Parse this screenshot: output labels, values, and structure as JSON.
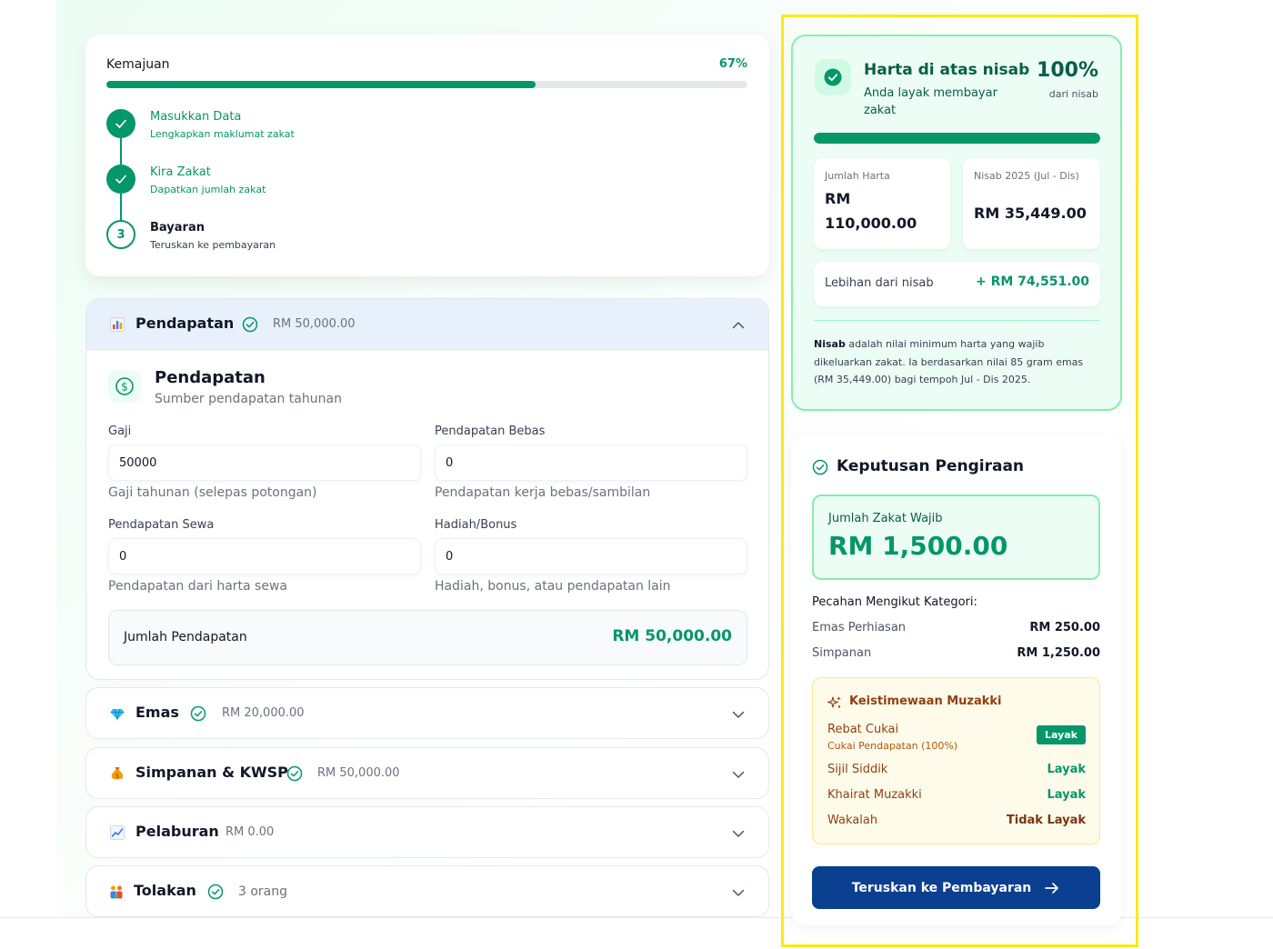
{
  "colors": {
    "accent": "#059669",
    "accent_dark": "#065f46",
    "primary_button": "#0b3f8f",
    "highlight": "#fde910",
    "amber": "#92400e"
  },
  "progress": {
    "title": "Kemajuan",
    "percent_label": "67%",
    "percent_value": 67,
    "steps": [
      {
        "title": "Masukkan Data",
        "subtitle": "Lengkapkan maklumat zakat",
        "status": "done"
      },
      {
        "title": "Kira Zakat",
        "subtitle": "Dapatkan jumlah zakat",
        "status": "done"
      },
      {
        "title": "Bayaran",
        "subtitle": "Teruskan ke pembayaran",
        "status": "current",
        "number": "3"
      }
    ]
  },
  "income": {
    "header": {
      "name": "Pendapatan",
      "amount": "RM 50,000.00",
      "icon": "bar-chart-icon",
      "completed_icon": "check-circle-icon",
      "toggle_icon": "chevron-up-icon"
    },
    "title": "Pendapatan",
    "subtitle": "Sumber pendapatan tahunan",
    "icon": "dollar-circle-icon",
    "fields": [
      {
        "label": "Gaji",
        "value": "50000",
        "help": "Gaji tahunan (selepas potongan)"
      },
      {
        "label": "Pendapatan Bebas",
        "value": "0",
        "help": "Pendapatan kerja bebas/sambilan"
      },
      {
        "label": "Pendapatan Sewa",
        "value": "0",
        "help": "Pendapatan dari harta sewa"
      },
      {
        "label": "Hadiah/Bonus",
        "value": "0",
        "help": "Hadiah, bonus, atau pendapatan lain"
      }
    ],
    "total_label": "Jumlah Pendapatan",
    "total_value": "RM 50,000.00"
  },
  "sections": [
    {
      "name": "Emas",
      "amount": "RM 20,000.00",
      "icon": "gem-icon",
      "completed": true
    },
    {
      "name": "Simpanan & KWSP",
      "amount": "RM 50,000.00",
      "icon": "money-bag-icon",
      "completed": true
    },
    {
      "name": "Pelaburan",
      "amount": "RM 0.00",
      "icon": "trend-chart-icon",
      "completed": false
    },
    {
      "name": "Tolakan",
      "amount": "3 orang",
      "icon": "family-icon",
      "completed": true
    }
  ],
  "nisab": {
    "title": "Harta di atas nisab",
    "subtitle": "Anda layak membayar zakat",
    "percent": "100%",
    "percent_sub": "dari nisab",
    "bar_percent": 100,
    "total_assets_label": "Jumlah Harta",
    "total_assets_currency": "RM",
    "total_assets_value": "110,000.00",
    "nisab_label": "Nisab 2025 (Jul - Dis)",
    "nisab_value": "RM 35,449.00",
    "excess_label": "Lebihan dari nisab",
    "excess_value": "+ RM 74,551.00",
    "note_term": "Nisab",
    "note_text": " adalah nilai minimum harta yang wajib dikeluarkan zakat. Ia berdasarkan nilai 85 gram emas (RM 35,449.00) bagi tempoh Jul - Dis 2025."
  },
  "decision": {
    "title": "Keputusan Pengiraan",
    "zakat_label": "Jumlah Zakat Wajib",
    "zakat_value": "RM 1,500.00",
    "breakdown_title": "Pecahan Mengikut Kategori:",
    "breakdown": [
      {
        "name": "Emas Perhiasan",
        "value": "RM 250.00"
      },
      {
        "name": "Simpanan",
        "value": "RM 1,250.00"
      }
    ],
    "privileges_title": "Keistimewaan Muzakki",
    "privileges": [
      {
        "name": "Rebat Cukai",
        "sub": "Cukai Pendapatan (100%)",
        "status": "Layak",
        "style": "badge",
        "color": "#059669"
      },
      {
        "name": "Sijil Siddik",
        "status": "Layak",
        "style": "text",
        "color": "#059669"
      },
      {
        "name": "Khairat Muzakki",
        "status": "Layak",
        "style": "text",
        "color": "#059669"
      },
      {
        "name": "Wakalah",
        "status": "Tidak Layak",
        "style": "text",
        "color": "#78350f"
      }
    ],
    "pay_button": "Teruskan ke Pembayaran"
  }
}
